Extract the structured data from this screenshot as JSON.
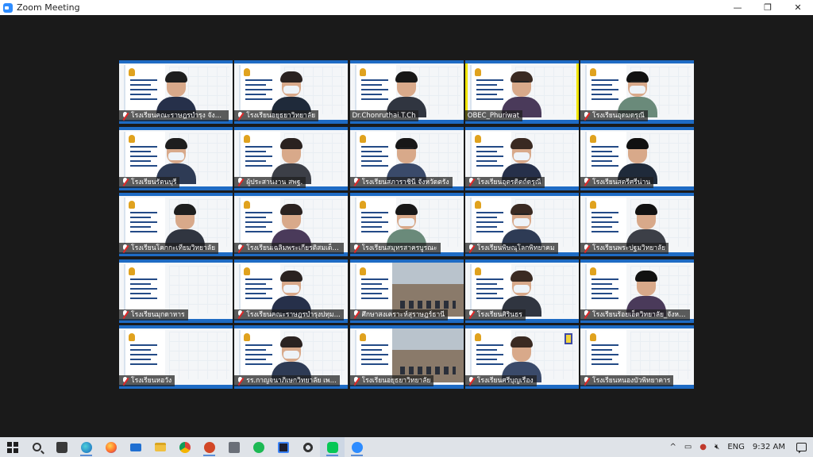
{
  "window": {
    "title": "Zoom Meeting",
    "controls": [
      "—",
      "❐",
      "✕"
    ]
  },
  "participants": [
    {
      "name": "โรงเรียนคณะราษฎรบำรุง จังห..."
    },
    {
      "name": "โรงเรียนอยุธยาวิทยาลัย"
    },
    {
      "name": "Dr.Chonruthai.T.Ch"
    },
    {
      "name": "OBEC_Phuriwat"
    },
    {
      "name": "โรงเรียนอุดมดรุณี"
    },
    {
      "name": "โรงเรียนรัตนบุรี"
    },
    {
      "name": "ผู้ประสานงาน สพฐ."
    },
    {
      "name": "โรงเรียนสภาราชินี จังหวัดตรัง"
    },
    {
      "name": "โรงเรียนอุตรดิตถ์ดรุณี"
    },
    {
      "name": "โรงเรียนสตรีศรีน่าน"
    },
    {
      "name": "โรงเรียนโคกกะเทียมวิทยาลัย"
    },
    {
      "name": "โรงเรียนเฉลิมพระเกียรติสมเด็จ..."
    },
    {
      "name": "โรงเรียนสมุทรสาครบูรณะ"
    },
    {
      "name": "โรงเรียนพิษณุโลกพิทยาคม"
    },
    {
      "name": "โรงเรียนพระปฐมวิทยาลัย"
    },
    {
      "name": "โรงเรียนมุกดาหาร"
    },
    {
      "name": "โรงเรียนคณะราษฎรบำรุงปทุม..."
    },
    {
      "name": "ศึกษาสงเคราะห์สุราษฎร์ธานี"
    },
    {
      "name": "โรงเรียนศิรินธร"
    },
    {
      "name": "โรงเรียนร้อยเอ็ดวิทยาลัย_จังหว..."
    },
    {
      "name": "โรงเรียนหอวัง"
    },
    {
      "name": "รร.กาญจนาภิเษกวิทยาลัย เพ..."
    },
    {
      "name": "โรงเรียนอยุธยาวิทยาลัย"
    },
    {
      "name": "โรงเรียนศรีบุญเรือง"
    },
    {
      "name": "โรงเรียนหนองบัวพิทยาคาร"
    }
  ],
  "active_speaker_index": 3,
  "taskbar": {
    "apps": [
      "start",
      "search",
      "store",
      "edge",
      "firefox",
      "mail",
      "explorer",
      "chrome",
      "powerpoint",
      "photos",
      "spotify",
      "vscode",
      "settings",
      "line",
      "zoom"
    ],
    "tray": {
      "chevron": "^",
      "language": "ENG",
      "time": "9:32 AM"
    }
  },
  "colors": {
    "tile_accent": "#1e6bc4",
    "active_border": "#f2e600",
    "meeting_bg": "#1a1a1a"
  }
}
